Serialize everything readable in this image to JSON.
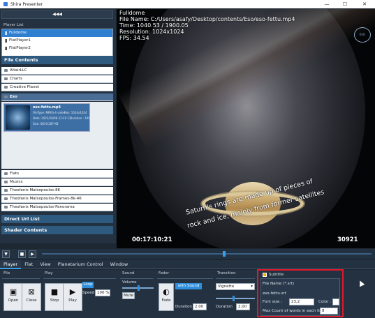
{
  "window": {
    "title": "Shira Presenter",
    "minimize": "—",
    "maximize": "☐",
    "close": "✕"
  },
  "left_panel": {
    "collapse_glyph": "◀◀◀",
    "player_list_label": "Player List",
    "players": [
      "Fulldome",
      "FlatPlayer1",
      "FlatPlayer2"
    ],
    "file_contents_label": "File Contents",
    "categories_top": [
      "AltairLLC",
      "Charts",
      "Creative Planet"
    ],
    "selected_category": "Eso",
    "file": {
      "name": "eso-fettu.mp4",
      "type": "FileType: MPEG-4 video",
      "res": "Res: 1024x1024",
      "date": "Date: 2022/10/08 23:21:13",
      "duration": "Duration : 1900.05 sn",
      "size": "Size: 6819,287 KB"
    },
    "categories_bottom": [
      "Flats",
      "Musics",
      "Theofanis Matsopoulos-8K",
      "Theofanis Matsopoulos-Frames-8k-46",
      "Theofanis Matsopoulos-Panorama"
    ],
    "direct_url_label": "Direct Url List",
    "shader_label": "Shader Contents"
  },
  "video": {
    "info": [
      "Fulldome",
      "File Name: C:/Users/asafy/Desktop/contents/Eso/eso-fettu.mp4",
      "Time: 1040.53 / 1900.05",
      "Resolution: 1024x1024",
      "FPS: 34.54"
    ],
    "subtitle_lines": [
      "Saturn's rings are made up of pieces of",
      "rock and ice, mainly from former satellites"
    ],
    "timecode": "00:17:10:21",
    "frame": "30921",
    "logo_text": "ESO"
  },
  "controls": {
    "collapse": "▼",
    "stop": "■",
    "play": "▶",
    "seek_fraction": 0.548
  },
  "tabs": [
    "Player",
    "Flat",
    "View",
    "Planetarium Control",
    "Window"
  ],
  "active_tab": "Player",
  "groups": {
    "file": {
      "label": "File",
      "open": "Open",
      "close": "Close"
    },
    "play": {
      "label": "Play",
      "stop": "Stop",
      "play": "Play",
      "loop": "Loop",
      "speed_label": "Speed",
      "speed_value": "100 %"
    },
    "sound": {
      "label": "Sound",
      "volume_label": "Volume",
      "mute": "Mute",
      "volume_fraction": 0.5
    },
    "fader": {
      "label": "Fader",
      "fade": "Fade",
      "with_sound": "with Sound",
      "duration_label": "Duration",
      "duration_value": "2,00"
    },
    "transition": {
      "label": "Transition",
      "type": "Vignette",
      "duration_label": "Duration",
      "duration_value": "2,00",
      "fraction": 0.45
    },
    "subtitle": {
      "label": "Subtitle",
      "file_name_label": "File Name (*.srt)",
      "file_name": "eso-fettu.srt",
      "font_size_label": "Font size :",
      "font_size": "23,2",
      "color_label": "Color :",
      "max_words_label": "Max Count of words in each line",
      "max_words": "8"
    }
  },
  "colors": {
    "accent": "#2f8fdc",
    "highlight_box": "#e0192b"
  }
}
